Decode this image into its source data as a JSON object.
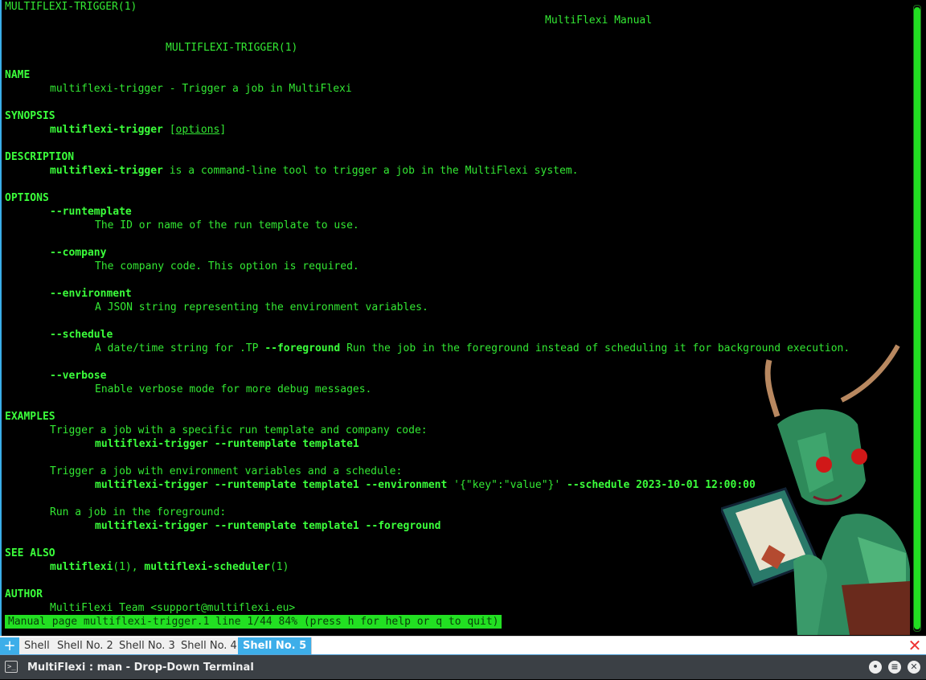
{
  "man": {
    "header_left": "MULTIFLEXI-TRIGGER(1)",
    "header_right": "MultiFlexi Manual",
    "center_title": "MULTIFLEXI-TRIGGER(1)",
    "name_heading": "NAME",
    "name_text": "multiflexi-trigger - Trigger a job in MultiFlexi",
    "synopsis_heading": "SYNOPSIS",
    "synopsis_cmd": "multiflexi-trigger",
    "synopsis_open": " [",
    "synopsis_options": "options",
    "synopsis_close": "]",
    "description_heading": "DESCRIPTION",
    "description_cmd": "multiflexi-trigger",
    "description_text": " is a command-line tool to trigger a job in the MultiFlexi system.",
    "options_heading": "OPTIONS",
    "opt_runtemplate": "--runtemplate",
    "opt_runtemplate_desc": "The ID or name of the run template to use.",
    "opt_company": "--company",
    "opt_company_desc": "The company code. This option is required.",
    "opt_environment": "--environment",
    "opt_environment_desc": "A JSON string representing the environment variables.",
    "opt_schedule": "--schedule",
    "opt_schedule_desc_a": "A date/time string for .TP ",
    "opt_schedule_fg": "--foreground",
    "opt_schedule_desc_b": " Run the job in the foreground instead of scheduling it for background execution.",
    "opt_verbose": "--verbose",
    "opt_verbose_desc": "Enable verbose mode for more debug messages.",
    "examples_heading": "EXAMPLES",
    "ex1_desc": "Trigger a job with a specific run template and company code:",
    "ex1_cmd": "multiflexi-trigger --runtemplate template1",
    "ex2_desc": "Trigger a job with environment variables and a schedule:",
    "ex2_cmd_a": "multiflexi-trigger --runtemplate template1 --environment",
    "ex2_cmd_b": " '{\"key\":\"value\"}' ",
    "ex2_cmd_c": "--schedule 2023-10-01 12:00:00",
    "ex3_desc": "Run a job in the foreground:",
    "ex3_cmd": "multiflexi-trigger --runtemplate template1 --foreground",
    "see_also_heading": "SEE ALSO",
    "see1": "multiflexi",
    "see1_sec": "(1), ",
    "see2": "multiflexi-scheduler",
    "see2_sec": "(1)",
    "author_heading": "AUTHOR",
    "author_text": "MultiFlexi Team <support@multiflexi.eu>",
    "status_line": "Manual page multiflexi-trigger.1 line 1/44 84% (press h for help or q to quit)"
  },
  "tabs": [
    {
      "label": "Shell",
      "active": false
    },
    {
      "label": "Shell No. 2",
      "active": false
    },
    {
      "label": "Shell No. 3",
      "active": false
    },
    {
      "label": "Shell No. 4",
      "active": false
    },
    {
      "label": "Shell No. 5",
      "active": true
    }
  ],
  "window": {
    "title": "MultiFlexi : man - Drop-Down Terminal"
  },
  "icons": {
    "add_tab": "plus-icon",
    "close_tab": "close-x-icon",
    "terminal": "terminal-icon",
    "minimize": "minimize-icon",
    "menu": "menu-icon",
    "close": "close-icon"
  },
  "colors": {
    "terminal_fg": "#33e833",
    "terminal_bg": "#000000",
    "accent": "#3daee9",
    "titlebar": "#3b4045"
  }
}
